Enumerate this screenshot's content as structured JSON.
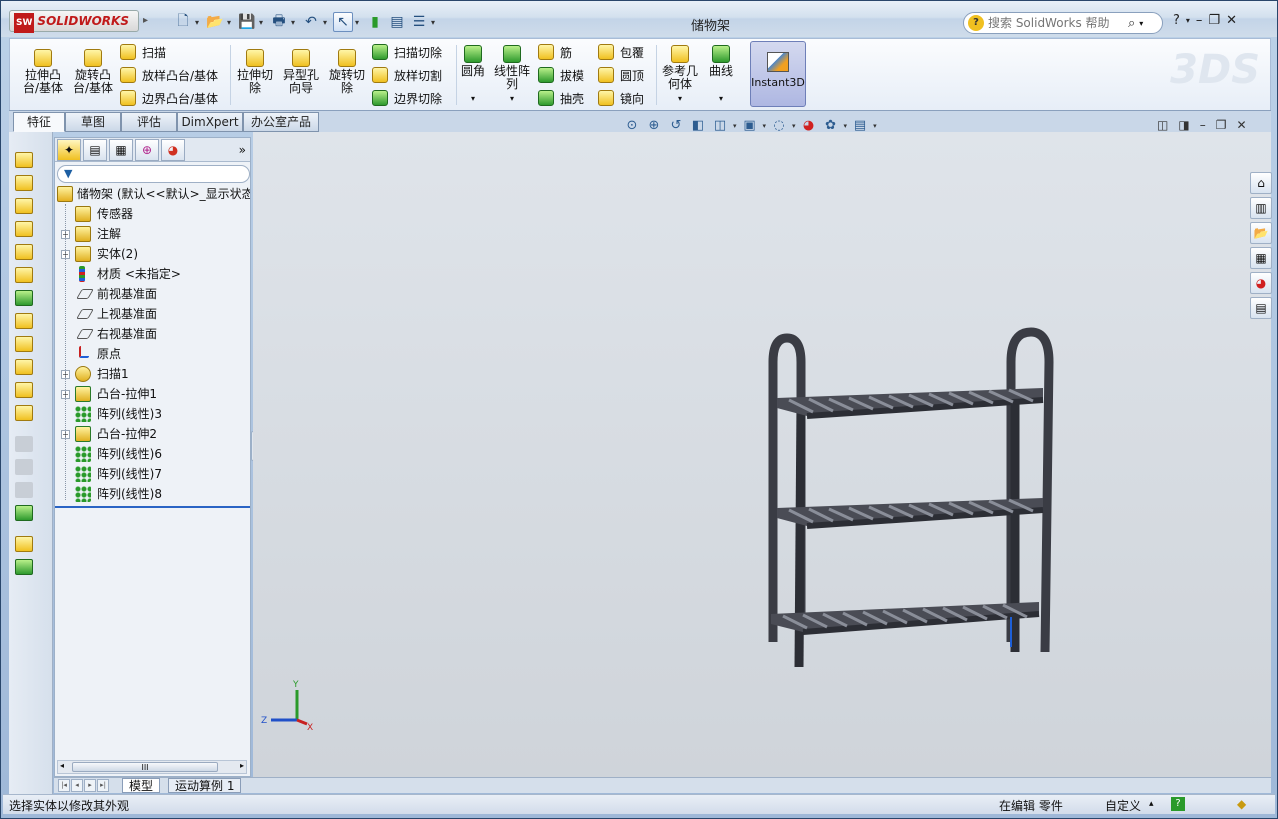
{
  "window": {
    "app_name": "SOLIDWORKS",
    "title": "储物架",
    "search_placeholder": "搜索 SolidWorks 帮助",
    "help_label": "?"
  },
  "ribbon": {
    "extrude_boss": "拉伸凸\n台/基体",
    "revolve_boss": "旋转凸\n台/基体",
    "sweep": "扫描",
    "loft_boss": "放样凸台/基体",
    "boundary_boss": "边界凸台/基体",
    "extrude_cut": "拉伸切\n除",
    "hole_wizard": "异型孔\n向导",
    "revolve_cut": "旋转切\n除",
    "sweep_cut": "扫描切除",
    "loft_cut": "放样切割",
    "boundary_cut": "边界切除",
    "fillet": "圆角",
    "linear_pattern": "线性阵\n列",
    "rib": "筋",
    "draft": "拔模",
    "shell": "抽壳",
    "wrap": "包覆",
    "dome": "圆顶",
    "mirror": "镜向",
    "ref_geometry": "参考几\n何体",
    "curves": "曲线",
    "instant3d": "Instant3D"
  },
  "command_tabs": [
    "特征",
    "草图",
    "评估",
    "DimXpert",
    "办公室产品"
  ],
  "feature_tree": {
    "root": "储物架  (默认<<默认>_显示状态",
    "items": [
      {
        "label": "传感器",
        "expandable": false,
        "icon": "sensor-icon"
      },
      {
        "label": "注解",
        "expandable": true,
        "icon": "annotation-icon"
      },
      {
        "label": "实体(2)",
        "expandable": true,
        "icon": "solid-bodies-icon"
      },
      {
        "label": "材质 <未指定>",
        "expandable": false,
        "icon": "material-icon"
      },
      {
        "label": "前视基准面",
        "expandable": false,
        "icon": "plane-icon"
      },
      {
        "label": "上视基准面",
        "expandable": false,
        "icon": "plane-icon"
      },
      {
        "label": "右视基准面",
        "expandable": false,
        "icon": "plane-icon"
      },
      {
        "label": "原点",
        "expandable": false,
        "icon": "origin-icon"
      },
      {
        "label": "扫描1",
        "expandable": true,
        "icon": "sweep-icon"
      },
      {
        "label": "凸台-拉伸1",
        "expandable": true,
        "icon": "extrude-icon"
      },
      {
        "label": "阵列(线性)3",
        "expandable": false,
        "icon": "linear-pattern-icon"
      },
      {
        "label": "凸台-拉伸2",
        "expandable": true,
        "icon": "extrude-icon"
      },
      {
        "label": "阵列(线性)6",
        "expandable": false,
        "icon": "linear-pattern-icon"
      },
      {
        "label": "阵列(线性)7",
        "expandable": false,
        "icon": "linear-pattern-icon"
      },
      {
        "label": "阵列(线性)8",
        "expandable": false,
        "icon": "linear-pattern-icon"
      }
    ]
  },
  "bottom_tabs": [
    "模型",
    "运动算例 1"
  ],
  "statusbar": {
    "message": "选择实体以修改其外观",
    "mode": "在编辑 零件",
    "units": "自定义"
  },
  "triad": {
    "y": "Y",
    "z": "Z",
    "x": "X"
  },
  "colors": {
    "viewport_bg": "#d6dbe1",
    "accent": "#2a64c4",
    "shelf_color": "#3a3c44"
  }
}
